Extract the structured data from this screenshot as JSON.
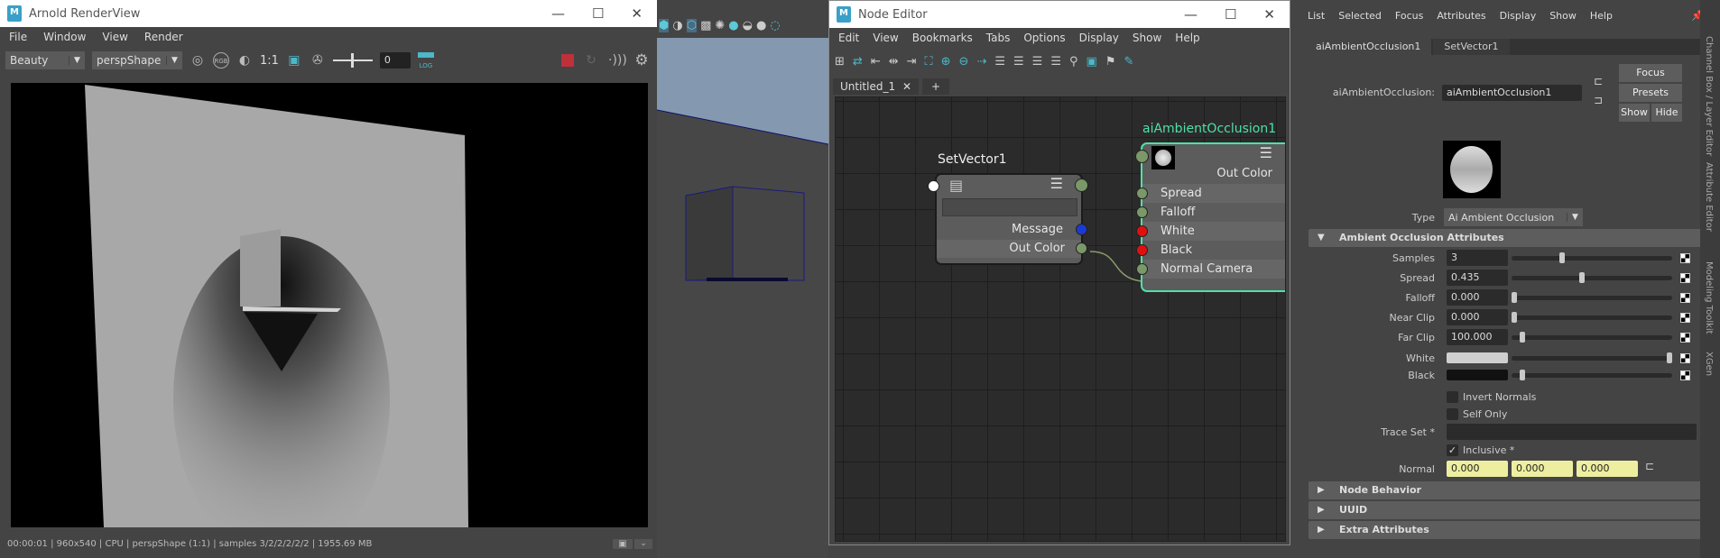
{
  "renderview": {
    "title": "Arnold RenderView",
    "menu": [
      "File",
      "Window",
      "View",
      "Render"
    ],
    "aov": "Beauty",
    "camera": "perspShape",
    "ratio": "1:1",
    "exposure": "0",
    "rgb": "RGB",
    "log": "LOG",
    "status": "00:00:01 |  960x540 | CPU | perspShape (1:1) | samples 3/2/2/2/2/2 | 1955.69 MB"
  },
  "node_editor": {
    "title": "Node Editor",
    "menu": [
      "Edit",
      "View",
      "Bookmarks",
      "Tabs",
      "Options",
      "Display",
      "Show",
      "Help"
    ],
    "tab": "Untitled_1",
    "tab_close": "✕",
    "tab_add": "+",
    "setvector": {
      "name": "SetVector1",
      "ports": [
        "Message",
        "Out Color"
      ]
    },
    "ao": {
      "name": "aiAmbientOcclusion1",
      "out": "Out Color",
      "ports": [
        "Spread",
        "Falloff",
        "White",
        "Black",
        "Normal Camera"
      ]
    },
    "accent": "#4fe0a8"
  },
  "attr_editor": {
    "menu": [
      "List",
      "Selected",
      "Focus",
      "Attributes",
      "Display",
      "Show",
      "Help"
    ],
    "tabs": [
      "aiAmbientOcclusion1",
      "SetVector1"
    ],
    "node_label": "aiAmbientOcclusion:",
    "node_value": "aiAmbientOcclusion1",
    "focus": "Focus",
    "presets": "Presets",
    "show": "Show",
    "hide": "Hide",
    "type_label": "Type",
    "type_value": "Ai Ambient Occlusion",
    "section": "Ambient Occlusion Attributes",
    "sliders": [
      {
        "label": "Samples",
        "value": "3",
        "fraction": 0.31
      },
      {
        "label": "Spread",
        "value": "0.435",
        "fraction": 0.435
      },
      {
        "label": "Falloff",
        "value": "0.000",
        "fraction": 0
      },
      {
        "label": "Near Clip",
        "value": "0.000",
        "fraction": 0
      },
      {
        "label": "Far Clip",
        "value": "100.000",
        "fraction": 0.05
      }
    ],
    "colors": [
      {
        "label": "White",
        "color": "#cfcfcf",
        "fraction": 1
      },
      {
        "label": "Black",
        "color": "#111111",
        "fraction": 0.05
      }
    ],
    "invert_normals": "Invert Normals",
    "self_only": "Self Only",
    "trace_set": "Trace Set *",
    "inclusive": "Inclusive *",
    "inclusive_check": "✓",
    "normal_label": "Normal",
    "normal": [
      "0.000",
      "0.000",
      "0.000"
    ],
    "collapsed": [
      "Node Behavior",
      "UUID",
      "Extra Attributes"
    ]
  },
  "side_tabs": [
    "Channel Box / Layer Editor",
    "Attribute Editor",
    "Modeling Toolkit",
    "XGen"
  ]
}
